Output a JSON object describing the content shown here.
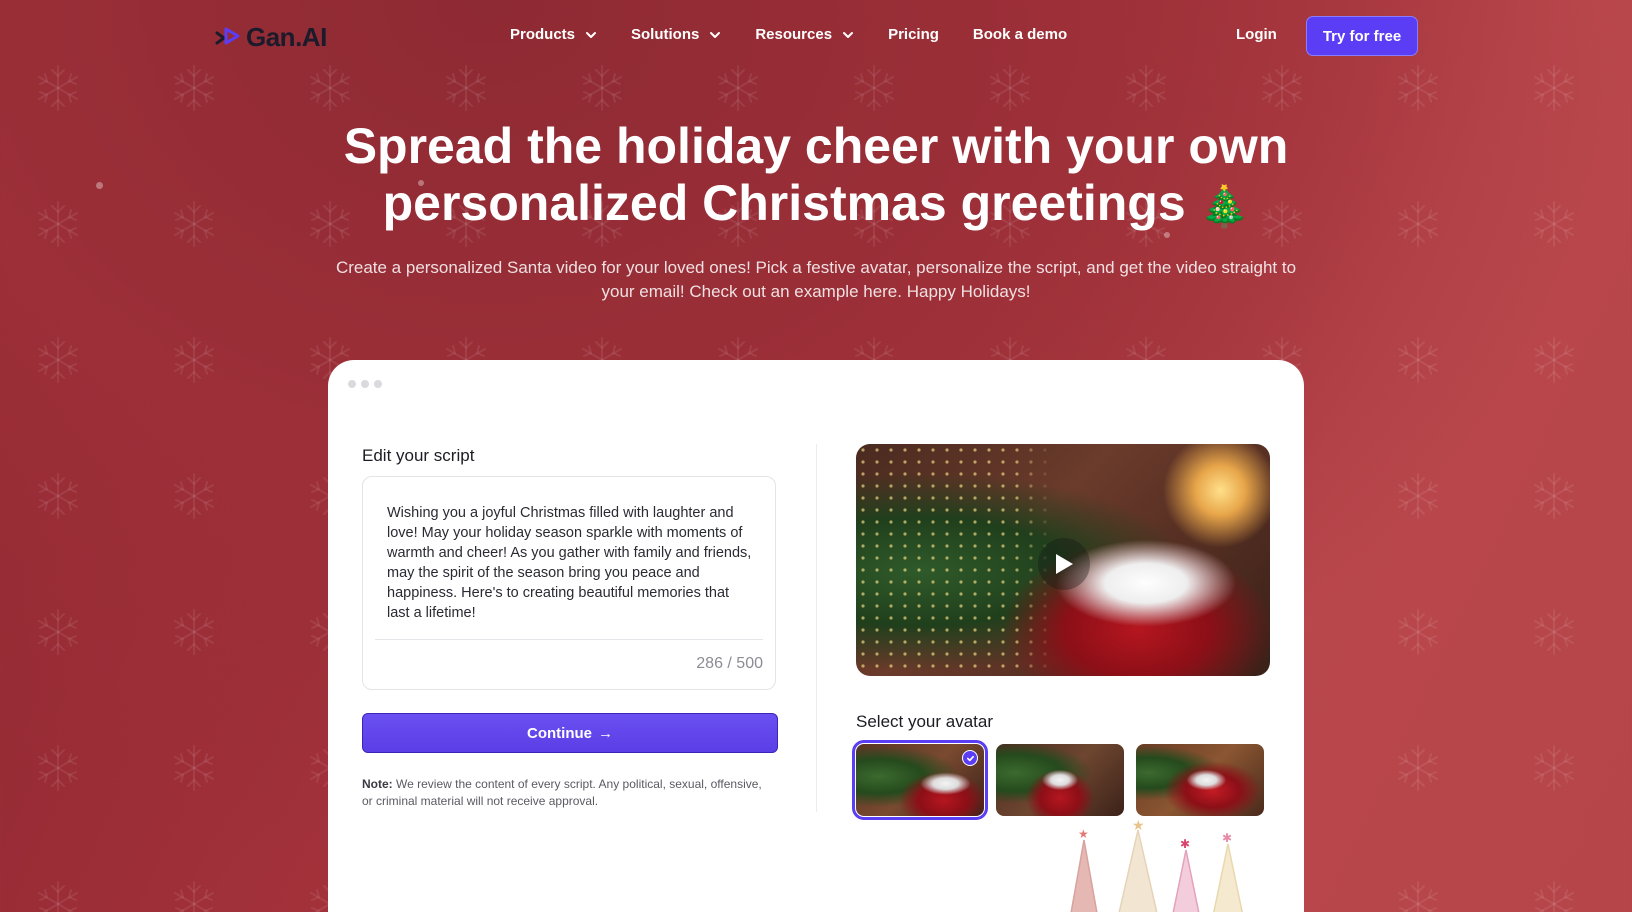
{
  "nav": {
    "logo_text": "Gan.AI",
    "links": [
      {
        "label": "Products",
        "dropdown": true
      },
      {
        "label": "Solutions",
        "dropdown": true
      },
      {
        "label": "Resources",
        "dropdown": true
      },
      {
        "label": "Pricing",
        "dropdown": false
      },
      {
        "label": "Book a demo",
        "dropdown": false
      }
    ],
    "login_label": "Login",
    "cta_label": "Try for free"
  },
  "hero": {
    "title_line1": "Spread the holiday cheer with your own",
    "title_line2": "personalized Christmas greetings",
    "title_emoji": "🎄",
    "subtitle": "Create a personalized Santa video for your loved ones! Pick a festive avatar, personalize the script, and get the video straight to your email! Check out an example here. Happy Holidays!"
  },
  "editor": {
    "label": "Edit your script",
    "script": "Wishing you a joyful Christmas filled with laughter and love! May your holiday season sparkle with moments of warmth and cheer! As you gather with family and friends, may the spirit of the season bring you peace and happiness. Here's to creating beautiful memories that last a lifetime!",
    "char_count": "286 / 500",
    "continue_label": "Continue",
    "continue_arrow": "→",
    "note_prefix": "Note:",
    "note_text": " We review the content of every script. Any political, sexual, offensive, or criminal material will not receive approval."
  },
  "preview": {
    "play_icon": "play-icon",
    "avatar_label": "Select your avatar",
    "avatars": [
      {
        "selected": true
      },
      {
        "selected": false
      },
      {
        "selected": false
      }
    ]
  },
  "colors": {
    "accent": "#5b3df5",
    "background": "#a8343d",
    "card": "#ffffff"
  }
}
